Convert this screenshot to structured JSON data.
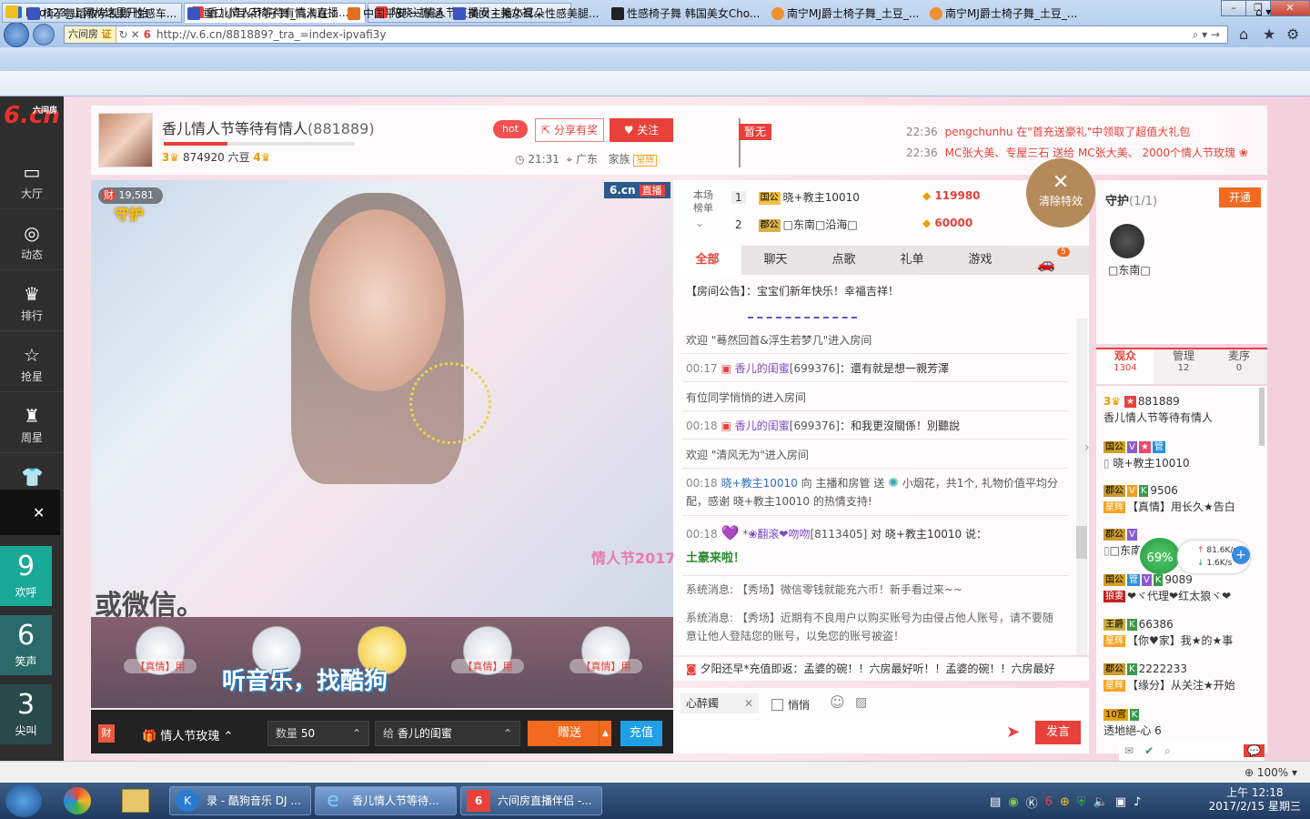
{
  "browser": {
    "address_label": "六间房",
    "address_cert": "证",
    "url": "http://v.6.cn/881889?_tra_=index-ipvafi3y",
    "tabs": [
      {
        "label": "hao123_上网从这里开始"
      },
      {
        "label": "香儿情人节等待有情人直播..."
      },
      {
        "label": "陪晓过情人节直播间 - 美女视..."
      }
    ],
    "favorites": [
      {
        "label": "椅子舞蹈教学视频 性感车..."
      },
      {
        "label": "重口小耳朵椅子舞_高清在..."
      },
      {
        "label": "中国平安-一账通"
      },
      {
        "label": "美女主播小耳朵性感美腿..."
      },
      {
        "label": "性感椅子舞 韩国美女Cho..."
      },
      {
        "label": "南宁MJ爵士椅子舞_土豆_..."
      },
      {
        "label": "南宁MJ爵士椅子舞_土豆_..."
      }
    ],
    "zoom": "100%"
  },
  "sidebar": {
    "logo": "6.cn",
    "logo_sub": "六间房",
    "items": [
      {
        "label": "大厅",
        "icon": "tv-icon"
      },
      {
        "label": "动态",
        "icon": "compass-icon"
      },
      {
        "label": "排行",
        "icon": "crown-icon"
      },
      {
        "label": "抢星",
        "icon": "star-icon"
      },
      {
        "label": "周星",
        "icon": "trophy-icon"
      },
      {
        "label": "马甲",
        "icon": "shirt-icon"
      }
    ],
    "moods": [
      {
        "num": "9",
        "label": "欢呼"
      },
      {
        "num": "6",
        "label": "笑声"
      },
      {
        "num": "3",
        "label": "尖叫"
      }
    ]
  },
  "room": {
    "title": "香儿情人节等待有情人",
    "room_id": "(881889)",
    "level": "3",
    "beans": "874920 六豆",
    "level2": "4",
    "hot": "hot",
    "share": "分享有奖",
    "follow": "关注",
    "time": "21:31",
    "location": "广东",
    "family_label": "家族",
    "family_tag": "星辉",
    "flag": "暂无",
    "notices": [
      {
        "time": "22:36",
        "text": "pengchunhu 在\"首充送豪礼\"中领取了超值大礼包"
      },
      {
        "time": "22:36",
        "text": "MC张大美、专屋三石 送给 MC张大美、 2000个情人节玫瑰"
      }
    ]
  },
  "video": {
    "badge": "6.cn",
    "badge_live": "直播",
    "wealth": "19,581",
    "wealth_icon": "财",
    "guard_logo": "守护",
    "overlay_text": "或微信。",
    "event_text": "情人节2017",
    "music_text": "听音乐，找酷狗",
    "gift_tags": [
      "【真情】用",
      "【真情】用",
      "【真情】用",
      "【真情】用"
    ],
    "controls": {
      "cai": "财",
      "gift": "情人节玫瑰",
      "qty_label": "数量",
      "qty": "50",
      "to_label": "给",
      "to": "香儿的闺蜜",
      "send": "赠送",
      "recharge": "充值"
    }
  },
  "ranking": {
    "label": "本场榜单",
    "rows": [
      {
        "rank": "1",
        "badge": "国公",
        "name": "晓+教主10010",
        "value": "119980"
      },
      {
        "rank": "2",
        "badge": "郡公",
        "name": "□东南□沿海□",
        "value": "60000"
      }
    ],
    "clear": "清除特效"
  },
  "chat": {
    "tabs": [
      "全部",
      "聊天",
      "点歌",
      "礼单",
      "游戏"
    ],
    "car_count": "5",
    "announcement": "【房间公告】：宝宝们新年快乐！幸福吉祥！",
    "messages": [
      {
        "text": "欢迎 \"蓦然回首&浮生若梦几\"进入房间"
      },
      {
        "time": "00:17",
        "user": "香儿的闺蜜",
        "uid": "[699376]",
        "text": "：還有就是想一親芳澤"
      },
      {
        "text": "有位同学悄悄的进入房间"
      },
      {
        "time": "00:18",
        "user": "香儿的闺蜜",
        "uid": "[699376]",
        "text": "：和我更沒關係！別聽說"
      },
      {
        "text": "欢迎 \"清风无为\"进入房间"
      },
      {
        "time": "00:18",
        "user": "晓+教主10010",
        "text": "向 主播和房管 送",
        "gift": "小烟花，共1个, 礼物价值平均分配，感谢 晓+教主10010 的热情支持!"
      },
      {
        "time": "00:18",
        "user": "*❀翻滚❤吻吻",
        "uid": "[8113405]",
        "text": "对 晓+教主10010 说：",
        "extra": "土豪来啦！"
      }
    ],
    "system": [
      "系统消息: 【秀场】微信零钱就能充六币！新手看过来~~",
      "系统消息: 【秀场】近期有不良用户以购买账号为由侵占他人账号，请不要随意让他人登陆您的账号，以免您的账号被盗！"
    ],
    "ticker": "夕阳还早*充值即返：孟婆的碗！！六房最好听！！孟婆的碗！！六房最好",
    "to_chip": "心醉鐲",
    "quiet": "悄悄",
    "send": "发言",
    "input_value": ""
  },
  "guard": {
    "title": "守护",
    "count": "(1/1)",
    "open": "开通",
    "member": "□东南□"
  },
  "users": {
    "tabs": [
      {
        "label": "观众",
        "count": "1304"
      },
      {
        "label": "管理",
        "count": "12"
      },
      {
        "label": "麦序",
        "count": "0"
      }
    ],
    "list": [
      {
        "id": "881889",
        "name": "香儿情人节等待有情人",
        "tag": "3"
      },
      {
        "tag": "国公",
        "name": "晓+教主10010"
      },
      {
        "tag": "郡公",
        "id": "9506",
        "name": "【真情】用长久★告白"
      },
      {
        "tag": "郡公",
        "name": "□东南"
      },
      {
        "tag": "国公",
        "id": "9089",
        "name": "❤ヾ代理❤红太狼ヾ❤",
        "tag2": "狼妻"
      },
      {
        "tag": "王爵",
        "id": "66386",
        "name": "【你♥家】我★的★事"
      },
      {
        "tag": "郡公",
        "id": "2222233",
        "name": "【缘分】从关注★开始"
      },
      {
        "tag": "10宫",
        "name": "透地絕-心 6"
      }
    ],
    "net_percent": "69%",
    "net_up": "81.6K/s",
    "net_down": "1.6K/s"
  },
  "taskbar": {
    "items": [
      {
        "label": "录 - 酷狗音乐 DJ ..."
      },
      {
        "label": "香儿情人节等待..."
      },
      {
        "label": "六间房直播伴侣 -..."
      }
    ],
    "time": "上午 12:18",
    "date": "2017/2/15 星期三"
  },
  "colors": {
    "brand": "#e8413a",
    "accent": "#f16a20",
    "blue": "#1fa0e6"
  }
}
